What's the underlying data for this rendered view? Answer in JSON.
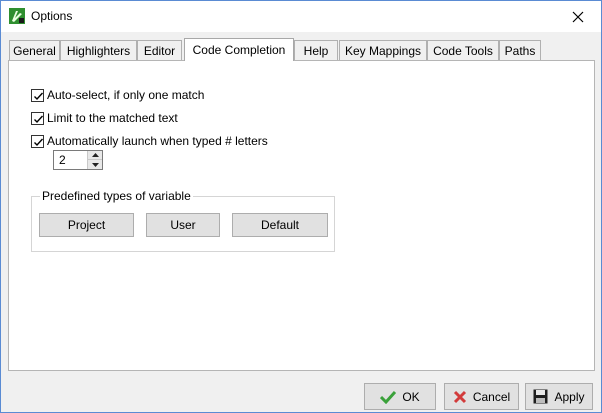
{
  "window": {
    "title": "Options"
  },
  "tabs": [
    {
      "label": "General"
    },
    {
      "label": "Highlighters"
    },
    {
      "label": "Editor"
    },
    {
      "label": "Code Completion"
    },
    {
      "label": "Help"
    },
    {
      "label": "Key Mappings"
    },
    {
      "label": "Code Tools"
    },
    {
      "label": "Paths"
    }
  ],
  "active_tab": "Code Completion",
  "options": {
    "auto_select": {
      "label": "Auto-select, if only one match",
      "checked": true
    },
    "limit_matched": {
      "label": "Limit to the matched text",
      "checked": true
    },
    "auto_launch": {
      "label": "Automatically launch when typed # letters",
      "checked": true
    },
    "letters_count": "2"
  },
  "predefined": {
    "label": "Predefined types of variable",
    "buttons": [
      "Project",
      "User",
      "Default"
    ]
  },
  "footer": {
    "ok": "OK",
    "cancel": "Cancel",
    "apply": "Apply"
  },
  "colors": {
    "window_border": "#5a8bd3",
    "ok_icon": "#3aa13a",
    "cancel_icon": "#d23b3b"
  },
  "icons": {
    "app": "leaf-app-icon",
    "close": "close-icon",
    "ok": "checkmark-icon",
    "cancel": "x-icon",
    "apply": "floppy-disk-icon"
  }
}
